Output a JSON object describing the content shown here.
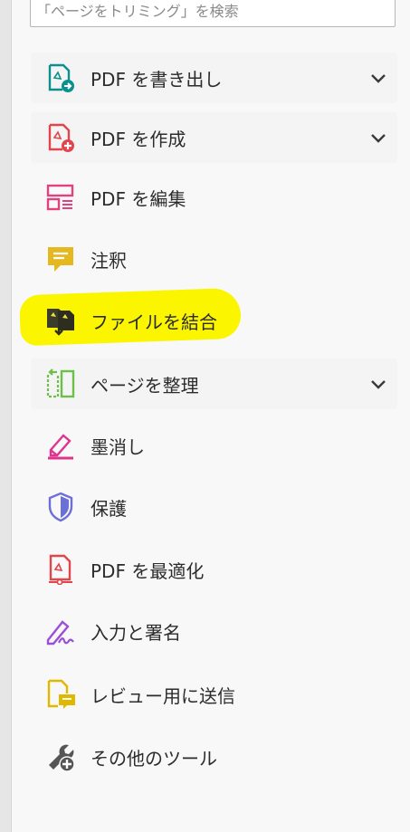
{
  "search": {
    "placeholder": "「ページをトリミング」を検索"
  },
  "tools": [
    {
      "label": "PDF を書き出し",
      "icon": "export-pdf-icon",
      "expandable": true
    },
    {
      "label": "PDF を作成",
      "icon": "create-pdf-icon",
      "expandable": true
    },
    {
      "label": "PDF を編集",
      "icon": "edit-pdf-icon",
      "expandable": false
    },
    {
      "label": "注釈",
      "icon": "comment-icon",
      "expandable": false
    },
    {
      "label": "ファイルを結合",
      "icon": "combine-files-icon",
      "expandable": false,
      "highlighted": true
    },
    {
      "label": "ページを整理",
      "icon": "organize-pages-icon",
      "expandable": true
    },
    {
      "label": "墨消し",
      "icon": "redact-icon",
      "expandable": false
    },
    {
      "label": "保護",
      "icon": "protect-shield-icon",
      "expandable": false
    },
    {
      "label": "PDF を最適化",
      "icon": "optimize-pdf-icon",
      "expandable": false
    },
    {
      "label": "入力と署名",
      "icon": "fill-sign-icon",
      "expandable": false
    },
    {
      "label": "レビュー用に送信",
      "icon": "send-review-icon",
      "expandable": false
    },
    {
      "label": "その他のツール",
      "icon": "more-tools-icon",
      "expandable": false
    }
  ],
  "colors": {
    "highlight": "#fbf500",
    "export": "#0c8f8f",
    "create": "#e0464c",
    "edit": "#e1417f",
    "comment": "#e6b820",
    "organize": "#6cc04a",
    "redact": "#e0338c",
    "protect": "#6b6fd6",
    "fillsign": "#9b4fd6"
  }
}
